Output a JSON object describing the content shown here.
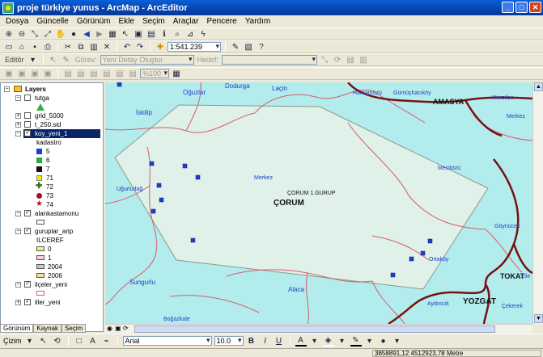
{
  "window": {
    "title": "proje türkiye yunus - ArcMap - ArcEditor"
  },
  "menu": [
    "Dosya",
    "Güncelle",
    "Görünüm",
    "Ekle",
    "Seçim",
    "Araçlar",
    "Pencere",
    "Yardım"
  ],
  "toolbar": {
    "scale": "1:541.239"
  },
  "editor": {
    "label": "Editör",
    "task_label": "Görev:",
    "task_value": "Yeni Detay Oluştur",
    "target_label": "Hedef:",
    "target_value": ""
  },
  "georef": {
    "zoom": "%100"
  },
  "toc": {
    "root": "Layers",
    "layers": [
      {
        "name": "tutga"
      },
      {
        "name": "grid_5000"
      },
      {
        "name": "t_250.sid"
      },
      {
        "name": "koy_yeni_1",
        "field": "kadastro",
        "classes": [
          "5",
          "6",
          "7",
          "71",
          "72",
          "73",
          "74"
        ]
      },
      {
        "name": "alankastamonu"
      },
      {
        "name": "guruplar_arip",
        "field": "ILCEREF",
        "classes": [
          "0",
          "1",
          "2004",
          "2006"
        ]
      },
      {
        "name": "ilçeler_yeni"
      },
      {
        "name": "iller_yeni"
      }
    ],
    "tabs": [
      "Görünüm",
      "Kaynak",
      "Seçim"
    ]
  },
  "map": {
    "labels": [
      {
        "text": "Dodurga",
        "name": "label-dodurga"
      },
      {
        "text": "Laçin",
        "name": "label-lacin"
      },
      {
        "text": "Oğuzlar",
        "name": "label-oguzlar"
      },
      {
        "text": "Hamamözü",
        "name": "label-hamamozu"
      },
      {
        "text": "Gümüşhacıköy",
        "name": "label-gumushacikoy"
      },
      {
        "text": "Merzifon",
        "name": "label-merzifon"
      },
      {
        "text": "İskilip",
        "name": "label-iskilip"
      },
      {
        "text": "AMASYA",
        "name": "label-amasya"
      },
      {
        "text": "Merkez",
        "name": "label-merkez-amasya"
      },
      {
        "text": "Merkez",
        "name": "label-merkez"
      },
      {
        "text": "Mecitözü",
        "name": "label-mecitozu"
      },
      {
        "text": "Uğurludağ",
        "name": "label-ugurludag"
      },
      {
        "text": "ÇORUM 1.GURUP",
        "name": "label-corum-gurup"
      },
      {
        "text": "ÇORUM",
        "name": "label-corum"
      },
      {
        "text": "Göynücek",
        "name": "label-goynucek"
      },
      {
        "text": "Ortaköy",
        "name": "label-ortakoy"
      },
      {
        "text": "Sungurlu",
        "name": "label-sungurlu"
      },
      {
        "text": "Alaca",
        "name": "label-alaca"
      },
      {
        "text": "TOKAT",
        "name": "label-tokat"
      },
      {
        "text": "Zile",
        "name": "label-zile"
      },
      {
        "text": "Aydıncık",
        "name": "label-aydincik"
      },
      {
        "text": "YOZGAT",
        "name": "label-yozgat"
      },
      {
        "text": "Boğazkale",
        "name": "label-bogazkale"
      },
      {
        "text": "Çekerek",
        "name": "label-cekerek"
      }
    ]
  },
  "draw": {
    "label": "Çizim",
    "font": "Arial",
    "size": "10.0",
    "bold": "B",
    "italic": "I",
    "underline": "U"
  },
  "status": {
    "coords": "3858891,12  4512923,78 Metre"
  },
  "colors": {
    "titlebar": "#0644b0",
    "map_bg": "#b2ecec",
    "group_fill": "#dff1e9",
    "province_border": "#7a1010",
    "district_border": "#d65c6c",
    "village_point": "#1f3fcf",
    "selected": "#0a246a"
  }
}
